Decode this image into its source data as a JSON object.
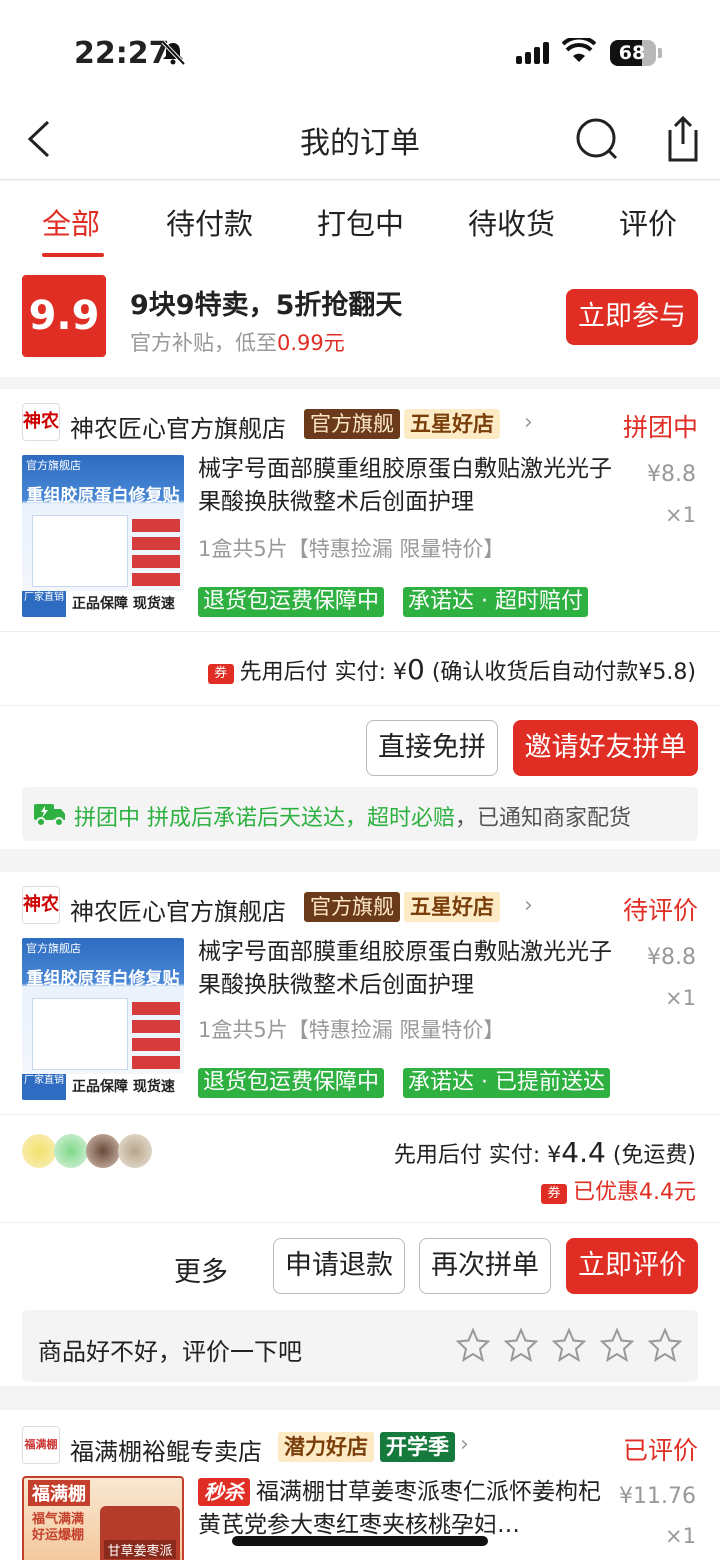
{
  "status_bar": {
    "time": "22:27",
    "battery": "68"
  },
  "nav": {
    "title": "我的订单"
  },
  "tabs": [
    {
      "label": "全部"
    },
    {
      "label": "待付款"
    },
    {
      "label": "打包中"
    },
    {
      "label": "待收货"
    },
    {
      "label": "评价"
    }
  ],
  "promo": {
    "badge": "9.9",
    "title": "9块9特卖，5折抢翻天",
    "subtitle_prefix": "官方补贴，低至",
    "subtitle_price": "0.99元",
    "button": "立即参与"
  },
  "orders": [
    {
      "store_logo": "神农",
      "store": "神农匠心官方旗舰店",
      "tag1": "官方旗舰",
      "tag2": "五星好店",
      "status": "拼团中",
      "thumb_shop": "官方旗舰店",
      "thumb_title": "重组胶原蛋白修复贴",
      "thumb_footer": "正品保障 现货速发",
      "thumb_maker": "厂家直销",
      "title": "械字号面部膜重组胶原蛋白敷贴激光光子果酸换肤微整术后创面护理",
      "spec": "1盒共5片【特惠捡漏 限量特价】",
      "price": "¥8.8",
      "qty": "×1",
      "service1": "退货包运费保障中",
      "service2": "承诺达 · 超时赔付",
      "coupon_icon": "券",
      "pay_prefix": "先用后付 实付: ¥",
      "pay_amount": "0",
      "pay_suffix": " (确认收货后自动付款¥5.8)",
      "btn_secondary": "直接免拼",
      "btn_primary": "邀请好友拼单",
      "info_green": "拼团中 拼成后承诺后天送达，超时必赔",
      "info_gray": "，已通知商家配货"
    },
    {
      "store_logo": "神农",
      "store": "神农匠心官方旗舰店",
      "tag1": "官方旗舰",
      "tag2": "五星好店",
      "status": "待评价",
      "thumb_shop": "官方旗舰店",
      "thumb_title": "重组胶原蛋白修复贴",
      "thumb_footer": "正品保障 现货速发",
      "thumb_maker": "厂家直销",
      "title": "械字号面部膜重组胶原蛋白敷贴激光光子果酸换肤微整术后创面护理",
      "spec": "1盒共5片【特惠捡漏 限量特价】",
      "price": "¥8.8",
      "qty": "×1",
      "service1": "退货包运费保障中",
      "service2": "承诺达 · 已提前送达",
      "pay_prefix": "先用后付 实付: ¥",
      "pay_amount": "4.4",
      "pay_suffix": " (免运费)",
      "coupon_icon": "券",
      "discount": "已优惠4.4元",
      "btn_more": "更多",
      "btn_refund": "申请退款",
      "btn_reorder": "再次拼单",
      "btn_review": "立即评价",
      "review_prompt": "商品好不好，评价一下吧"
    },
    {
      "store_logo": "福满棚",
      "store": "福满棚裕鲲专卖店",
      "tag1": "潜力好店",
      "tag2": "开学季",
      "status": "已评价",
      "thumb_brand": "福满棚",
      "thumb_slogan": "福气满满 好运爆棚",
      "thumb_product": "甘草姜枣派",
      "flash_tag": "秒杀",
      "title": "福满棚甘草姜枣派枣仁派怀姜枸杞黄芪党参大枣红枣夹核桃孕妇…",
      "price": "¥11.76",
      "qty": "×1"
    }
  ],
  "colors": {
    "accent": "#e02e24",
    "green": "#2eb140",
    "brown_tag": "#6b3a1a",
    "gold_tag": "#fcebc4"
  }
}
